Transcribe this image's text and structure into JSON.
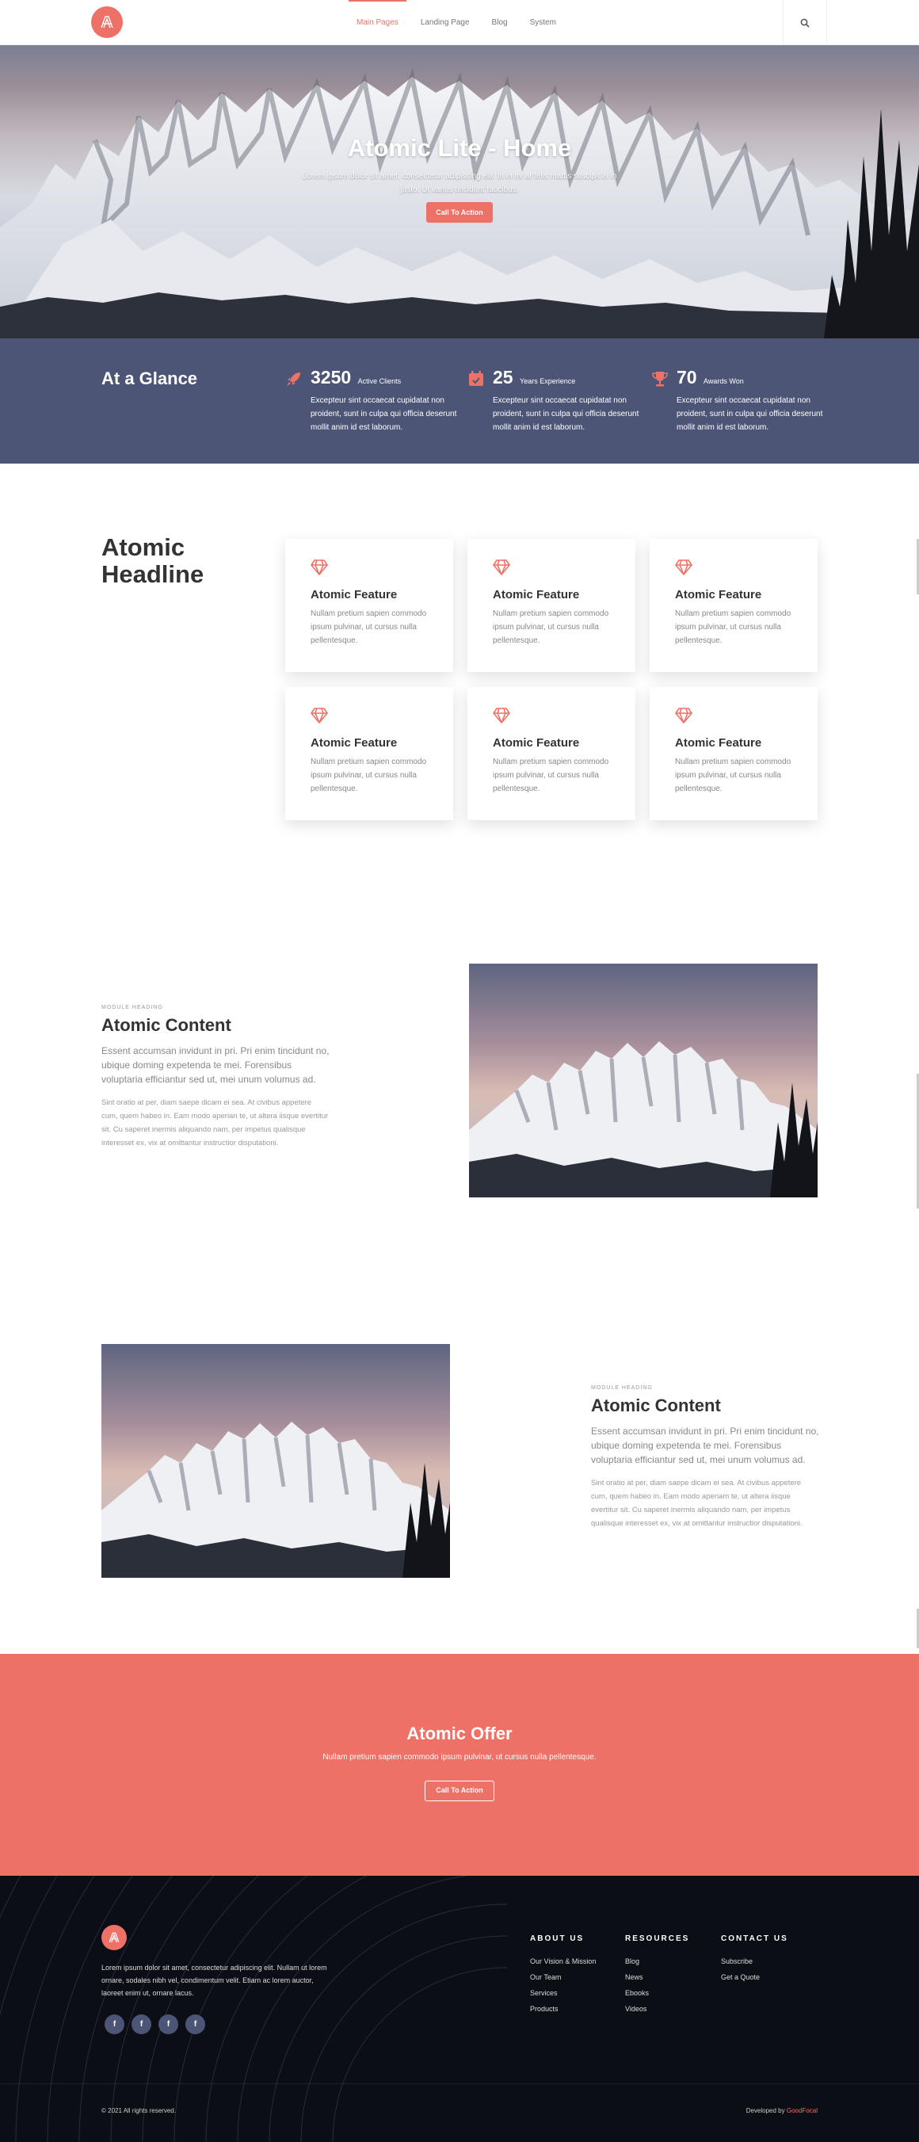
{
  "header": {
    "nav": [
      {
        "label": "Main Pages",
        "active": true
      },
      {
        "label": "Landing Page",
        "active": false
      },
      {
        "label": "Blog",
        "active": false
      },
      {
        "label": "System",
        "active": false
      }
    ],
    "icons": {
      "logo": "atomic-logo",
      "search": "search-icon"
    }
  },
  "hero": {
    "title": "Atomic Lite - Home",
    "subtitle": "Lorem ipsum dolor sit amet, consectetur adipiscing elit. In in mi at felis mattis suscipit in in justo. Ut varius tincidunt faucibus.",
    "cta": "Call To Action"
  },
  "glance": {
    "title": "At a Glance",
    "stats": [
      {
        "icon": "rocket-icon",
        "number": "3250",
        "label": "Active Clients",
        "desc": "Excepteur sint occaecat cupidatat non proident, sunt in culpa qui officia deserunt mollit anim id est laborum."
      },
      {
        "icon": "calendar-icon",
        "number": "25",
        "label": "Years Experience",
        "desc": "Excepteur sint occaecat cupidatat non proident, sunt in culpa qui officia deserunt mollit anim id est laborum."
      },
      {
        "icon": "trophy-icon",
        "number": "70",
        "label": "Awards Won",
        "desc": "Excepteur sint occaecat cupidatat non proident, sunt in culpa qui officia deserunt mollit anim id est laborum."
      }
    ]
  },
  "features": {
    "headline": "Atomic Headline",
    "items": [
      {
        "icon": "diamond-icon",
        "title": "Atomic Feature",
        "text": "Nullam pretium sapien commodo ipsum pulvinar, ut cursus nulla pellentesque."
      },
      {
        "icon": "diamond-icon",
        "title": "Atomic Feature",
        "text": "Nullam pretium sapien commodo ipsum pulvinar, ut cursus nulla pellentesque."
      },
      {
        "icon": "diamond-icon",
        "title": "Atomic Feature",
        "text": "Nullam pretium sapien commodo ipsum pulvinar, ut cursus nulla pellentesque."
      },
      {
        "icon": "diamond-icon",
        "title": "Atomic Feature",
        "text": "Nullam pretium sapien commodo ipsum pulvinar, ut cursus nulla pellentesque."
      },
      {
        "icon": "diamond-icon",
        "title": "Atomic Feature",
        "text": "Nullam pretium sapien commodo ipsum pulvinar, ut cursus nulla pellentesque."
      },
      {
        "icon": "diamond-icon",
        "title": "Atomic Feature",
        "text": "Nullam pretium sapien commodo ipsum pulvinar, ut cursus nulla pellentesque."
      }
    ]
  },
  "content_blocks": [
    {
      "kicker": "MODULE HEADING",
      "title": "Atomic Content",
      "lead": "Essent accumsan invidunt in pri. Pri enim tincidunt no, ubique doming expetenda te mei. Forensibus voluptaria efficiantur sed ut, mei unum volumus ad.",
      "body": "Sint oratio at per, diam saepe dicam ei sea. At civibus appetere cum, quem habeo in. Eam modo aperian te, ut altera iisque evertitur sit. Cu saperet inermis aliquando nam, per impetus qualisque interesset ex, vix at omittantur instructior disputationi."
    },
    {
      "kicker": "MODULE HEADING",
      "title": "Atomic Content",
      "lead": "Essent accumsan invidunt in pri. Pri enim tincidunt no, ubique doming expetenda te mei. Forensibus voluptaria efficiantur sed ut, mei unum volumus ad.",
      "body": "Sint oratio at per, diam saepe dicam ei sea. At civibus appetere cum, quem habeo in. Eam modo aperiam te, ut altera iisque evertitur sit. Cu saperet inermis aliquando nam, per impetus qualisque interesset ex, vix at omittantur instructior disputationi."
    }
  ],
  "offer": {
    "title": "Atomic Offer",
    "text": "Nullam pretium sapien commodo ipsum pulvinar, ut cursus nulla pellentesque.",
    "cta": "Call To Action"
  },
  "footer": {
    "about": "Lorem ipsum dolor sit amet, consectetur adipiscing elit. Nullam ut lorem ornare, sodales nibh vel, condimentum velit. Etiam ac lorem auctor, laoreet enim ut, ornare lacus.",
    "social": [
      "f",
      "f",
      "f",
      "f"
    ],
    "columns": [
      {
        "title": "ABOUT US",
        "links": [
          "Our Vision & Mission",
          "Our Team",
          "Services",
          "Products"
        ]
      },
      {
        "title": "RESOURCES",
        "links": [
          "Blog",
          "News",
          "Ebooks",
          "Videos"
        ]
      },
      {
        "title": "CONTACT US",
        "links": [
          "Subscribe",
          "Get a Quote"
        ]
      }
    ],
    "copyright": "© 2021 All rights reserved.",
    "developed_by": "Developed by",
    "developer": "GoodFocal"
  },
  "colors": {
    "accent": "#ee7167",
    "navy": "#4d5577",
    "footer_bg": "#0c0e16"
  }
}
